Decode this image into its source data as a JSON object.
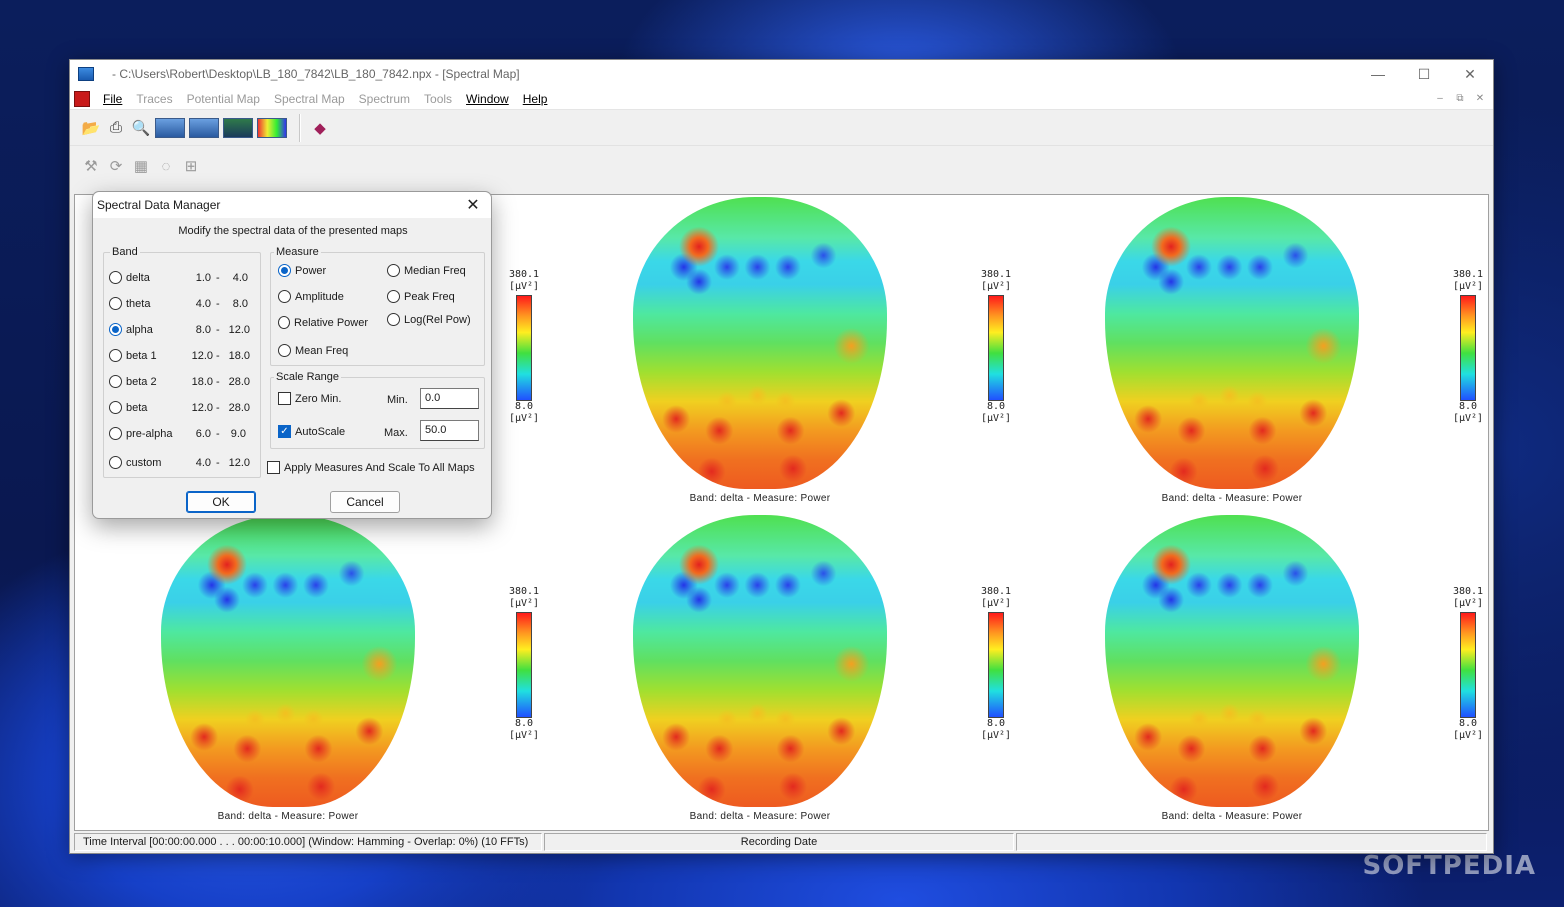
{
  "window": {
    "title": "- C:\\Users\\Robert\\Desktop\\LB_180_7842\\LB_180_7842.npx - [Spectral Map]",
    "controls": {
      "minimize": "—",
      "maximize": "☐",
      "close": "✕"
    }
  },
  "menu": {
    "file": "File",
    "traces": "Traces",
    "potential_map": "Potential Map",
    "spectral_map": "Spectral Map",
    "spectrum": "Spectrum",
    "tools": "Tools",
    "window": "Window",
    "help": "Help"
  },
  "mdi_controls": {
    "minimize": "–",
    "restore": "⧉",
    "close": "✕"
  },
  "maps": [
    {
      "caption": "Band: delta - Measure: Power",
      "scale_max": "380.1",
      "scale_min": "8.0",
      "unit": "[µV²]"
    },
    {
      "caption": "Band: delta - Measure: Power",
      "scale_max": "380.1",
      "scale_min": "8.0",
      "unit": "[µV²]"
    },
    {
      "caption": "Band: delta - Measure: Power",
      "scale_max": "380.1",
      "scale_min": "8.0",
      "unit": "[µV²]"
    },
    {
      "caption": "Band: delta - Measure: Power",
      "scale_max": "380.1",
      "scale_min": "8.0",
      "unit": "[µV²]"
    },
    {
      "caption": "Band: delta - Measure: Power",
      "scale_max": "380.1",
      "scale_min": "8.0",
      "unit": "[µV²]"
    },
    {
      "caption": "Band: delta - Measure: Power",
      "scale_max": "380.1",
      "scale_min": "8.0",
      "unit": "[µV²]"
    }
  ],
  "status": {
    "time_interval": "Time Interval [00:00:00.000 . . . 00:00:10.000] (Window: Hamming - Overlap: 0%) (10 FFTs)",
    "recording_date": "Recording Date"
  },
  "dialog": {
    "title": "Spectral Data Manager",
    "subtitle": "Modify the spectral data of the presented maps",
    "band_label": "Band",
    "bands": [
      {
        "name": "delta",
        "lo": "1.0",
        "hi": "4.0",
        "selected": false
      },
      {
        "name": "theta",
        "lo": "4.0",
        "hi": "8.0",
        "selected": false
      },
      {
        "name": "alpha",
        "lo": "8.0",
        "hi": "12.0",
        "selected": true
      },
      {
        "name": "beta 1",
        "lo": "12.0",
        "hi": "18.0",
        "selected": false
      },
      {
        "name": "beta 2",
        "lo": "18.0",
        "hi": "28.0",
        "selected": false
      },
      {
        "name": "beta",
        "lo": "12.0",
        "hi": "28.0",
        "selected": false
      },
      {
        "name": "pre-alpha",
        "lo": "6.0",
        "hi": "9.0",
        "selected": false
      },
      {
        "name": "custom",
        "lo": "4.0",
        "hi": "12.0",
        "selected": false
      }
    ],
    "dash": "-",
    "measure_label": "Measure",
    "measures": {
      "power": "Power",
      "amplitude": "Amplitude",
      "relative_power": "Relative Power",
      "mean_freq": "Mean Freq",
      "median_freq": "Median Freq",
      "peak_freq": "Peak Freq",
      "log_rel_pow": "Log(Rel Pow)",
      "selected": "power"
    },
    "scale_range_label": "Scale Range",
    "zero_min_label": "Zero Min.",
    "zero_min_checked": false,
    "autoscale_label": "AutoScale",
    "autoscale_checked": true,
    "min_label": "Min.",
    "min_value": "0.0",
    "max_label": "Max.",
    "max_value": "50.0",
    "apply_all_label": "Apply Measures And Scale To All Maps",
    "apply_all_checked": false,
    "ok_label": "OK",
    "cancel_label": "Cancel",
    "close": "✕"
  },
  "watermark": "SOFTPEDIA"
}
